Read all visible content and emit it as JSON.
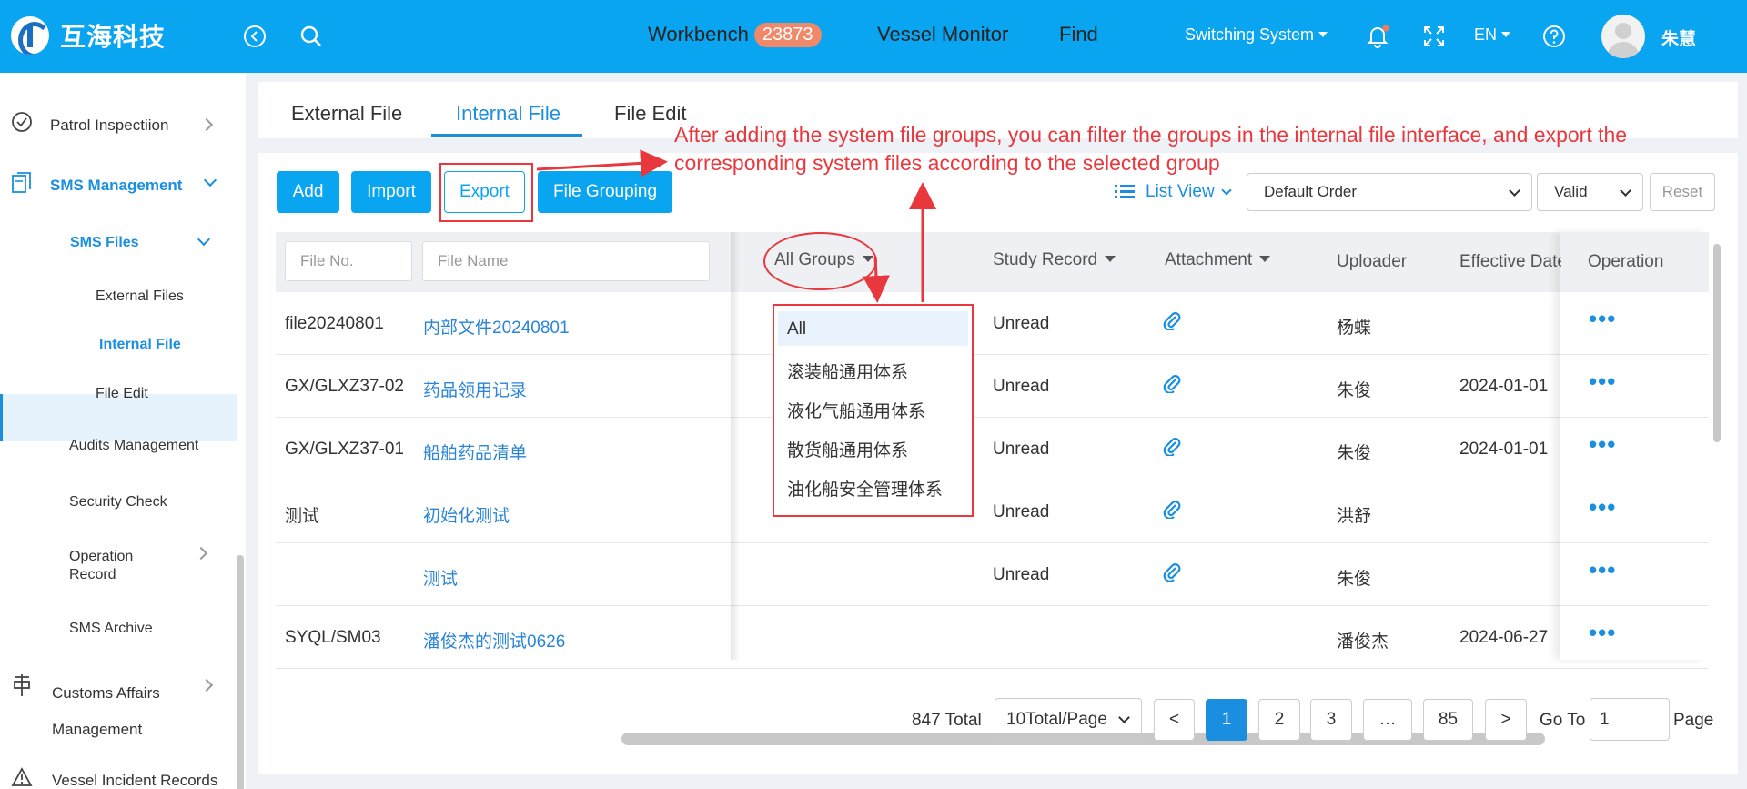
{
  "header": {
    "logo_text": "互海科技",
    "nav": {
      "workbench": "Workbench",
      "workbench_badge": "23873",
      "vessel_monitor": "Vessel Monitor",
      "find": "Find"
    },
    "switching_system": "Switching System",
    "lang": "EN",
    "user_name": "朱慧"
  },
  "sidebar": {
    "patrol": "Patrol Inspectiion",
    "sms_management": "SMS Management",
    "sms_files": "SMS Files",
    "external_files": "External Files",
    "internal_file": "Internal File",
    "file_edit": "File Edit",
    "audits": "Audits Management",
    "security_check": "Security Check",
    "operation_record_1": "Operation",
    "operation_record_2": "Record",
    "sms_archive": "SMS Archive",
    "customs_1": "Customs Affairs",
    "customs_2": "Management",
    "vessel_incident": "Vessel Incident Records"
  },
  "tabs": [
    "External File",
    "Internal File",
    "File Edit"
  ],
  "toolbar": {
    "add": "Add",
    "import": "Import",
    "export": "Export",
    "file_grouping": "File Grouping",
    "list_view": "List View",
    "order": "Default Order",
    "status": "Valid",
    "reset": "Reset"
  },
  "table": {
    "filter_file_no": "File No.",
    "filter_file_name": "File Name",
    "headers": {
      "all_groups": "All Groups",
      "study_record": "Study Record",
      "attachment": "Attachment",
      "uploader": "Uploader",
      "effective_date": "Effective Date",
      "operation": "Operation"
    },
    "rows": [
      {
        "file_no": "file20240801",
        "file_name": "内部文件20240801",
        "study": "Unread",
        "attachment": true,
        "uploader": "杨蝶",
        "date": ""
      },
      {
        "file_no": "GX/GLXZ37-02",
        "file_name": "药品领用记录",
        "study": "Unread",
        "attachment": true,
        "uploader": "朱俊",
        "date": "2024-01-01"
      },
      {
        "file_no": "GX/GLXZ37-01",
        "file_name": "船舶药品清单",
        "study": "Unread",
        "attachment": true,
        "uploader": "朱俊",
        "date": "2024-01-01"
      },
      {
        "file_no": "测试",
        "file_name": "初始化测试",
        "study": "Unread",
        "attachment": true,
        "uploader": "洪舒",
        "date": ""
      },
      {
        "file_no": "",
        "file_name": "测试",
        "study": "Unread",
        "attachment": true,
        "uploader": "朱俊",
        "date": ""
      },
      {
        "file_no": "SYQL/SM03",
        "file_name": "潘俊杰的测试0626",
        "study": "",
        "attachment": false,
        "uploader": "潘俊杰",
        "date": "2024-06-27"
      }
    ]
  },
  "group_dropdown": [
    "All",
    "滚装船通用体系",
    "液化气船通用体系",
    "散货船通用体系",
    "油化船安全管理体系"
  ],
  "pagination": {
    "total": "847 Total",
    "page_size": "10Total/Page",
    "prev": "<",
    "pages": [
      "1",
      "2",
      "3",
      "…",
      "85"
    ],
    "next": ">",
    "goto_label": "Go To",
    "goto_value": "1",
    "page_label": "Page"
  },
  "annotation": {
    "text": "After adding the system file groups, you can filter the groups in the internal file interface, and export the corresponding system files according to the selected group"
  },
  "colors": {
    "primary": "#0aa5f0",
    "link": "#2a84d8",
    "annotation": "#e8383d"
  }
}
